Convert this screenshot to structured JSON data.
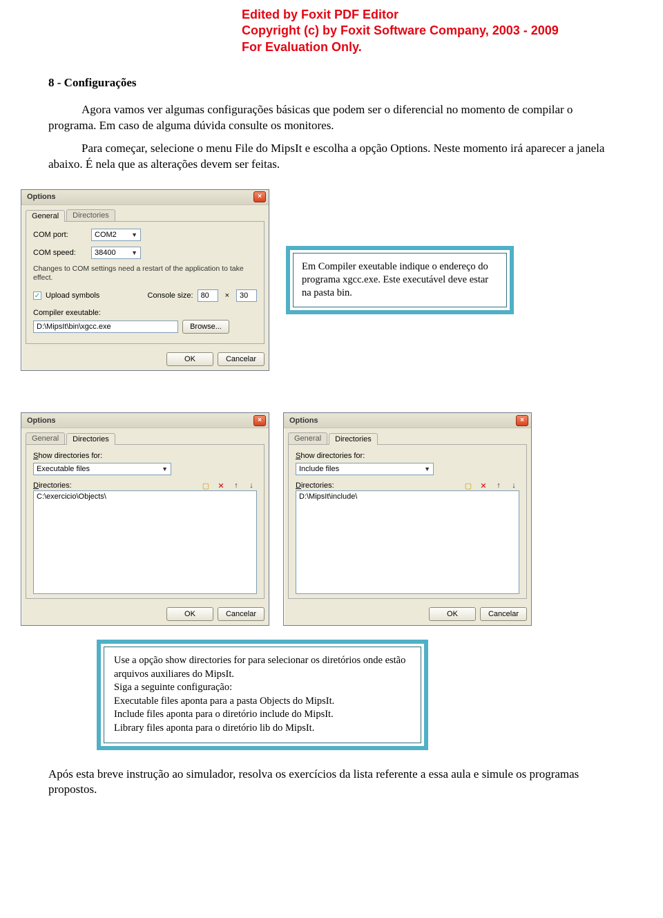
{
  "watermark": {
    "line1": "Edited by Foxit PDF Editor",
    "line2": "Copyright (c) by Foxit Software Company, 2003 - 2009",
    "line3": "For Evaluation Only."
  },
  "section_title": "8 - Configurações",
  "para1": "Agora vamos ver algumas configurações básicas que podem ser o diferencial no momento de compilar o programa. Em caso de alguma dúvida consulte os monitores.",
  "para2": "Para começar, selecione o menu File do MipsIt e escolha a opção Options. Neste momento irá aparecer a janela abaixo. É nela que as alterações devem ser feitas.",
  "dialog1": {
    "title": "Options",
    "tab_general": "General",
    "tab_directories": "Directories",
    "com_port_label": "COM port:",
    "com_port_value": "COM2",
    "com_speed_label": "COM speed:",
    "com_speed_value": "38400",
    "restart_note": "Changes to COM settings need a restart of the application to take effect.",
    "upload_symbols_label": "Upload symbols",
    "console_size_label": "Console size:",
    "console_w": "80",
    "console_h": "30",
    "x_sep": "×",
    "compiler_exe_label": "Compiler exeutable:",
    "compiler_exe_value": "D:\\MipsIt\\bin\\xgcc.exe",
    "browse": "Browse...",
    "ok": "OK",
    "cancel": "Cancelar"
  },
  "callout1_text": "Em Compiler exeutable indique o endereço do programa xgcc.exe. Este executável deve estar na pasta bin.",
  "dialog2": {
    "title": "Options",
    "tab_general": "General",
    "tab_directories": "Directories",
    "show_dirs_label": "Show directories for:",
    "show_dirs_value": "Executable files",
    "directories_label": "Directories:",
    "list_item": "C:\\exercicio\\Objects\\",
    "ok": "OK",
    "cancel": "Cancelar"
  },
  "dialog3": {
    "title": "Options",
    "tab_general": "General",
    "tab_directories": "Directories",
    "show_dirs_label": "Show directories for:",
    "show_dirs_value": "Include files",
    "directories_label": "Directories:",
    "list_item": "D:\\MipsIt\\include\\",
    "ok": "OK",
    "cancel": "Cancelar"
  },
  "callout2": {
    "l1": "Use a opção show directories for para selecionar os diretórios onde estão arquivos auxiliares do MipsIt.",
    "l2": "Siga a seguinte configuração:",
    "l3": "Executable files aponta para a pasta Objects do MipsIt.",
    "l4": "Include files aponta para o diretório include do MipsIt.",
    "l5": "Library files aponta para o diretório lib do MipsIt."
  },
  "closing": "Após esta breve instrução ao simulador, resolva os exercícios da lista referente a essa aula e simule os programas propostos."
}
